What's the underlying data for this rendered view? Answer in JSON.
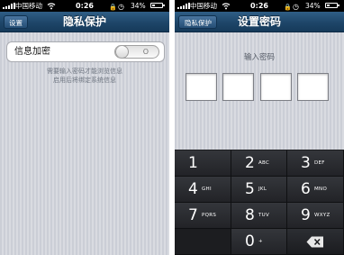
{
  "left_screen": {
    "status": {
      "carrier": "中国移动",
      "time": "0:26",
      "battery": "34%",
      "battery_level": 0.34
    },
    "nav": {
      "back_label": "设置",
      "title": "隐私保护"
    },
    "setting": {
      "label": "信息加密",
      "toggle_text": "O",
      "enabled": false
    },
    "hint": {
      "line1": "需要输入密码才能浏览信息",
      "line2": "启用后将绑定系统信息"
    }
  },
  "right_screen": {
    "status": {
      "carrier": "中国移动",
      "time": "0:26",
      "battery": "34%",
      "battery_level": 0.34
    },
    "nav": {
      "back_label": "隐私保护",
      "title": "设置密码"
    },
    "prompt": "输入密码",
    "password_boxes": 4,
    "keypad": [
      {
        "digit": "1",
        "letters": ""
      },
      {
        "digit": "2",
        "letters": "ABC"
      },
      {
        "digit": "3",
        "letters": "DEF"
      },
      {
        "digit": "4",
        "letters": "GHI"
      },
      {
        "digit": "5",
        "letters": "JKL"
      },
      {
        "digit": "6",
        "letters": "MNO"
      },
      {
        "digit": "7",
        "letters": "PQRS"
      },
      {
        "digit": "8",
        "letters": "TUV"
      },
      {
        "digit": "9",
        "letters": "WXYZ"
      },
      {
        "digit": "",
        "letters": ""
      },
      {
        "digit": "0",
        "letters": "+"
      },
      {
        "digit": "",
        "letters": "",
        "icon": "backspace-icon"
      }
    ]
  },
  "colors": {
    "navbar": "#1e4669",
    "background": "#d0d3da",
    "keypad": "#1e1f22"
  }
}
